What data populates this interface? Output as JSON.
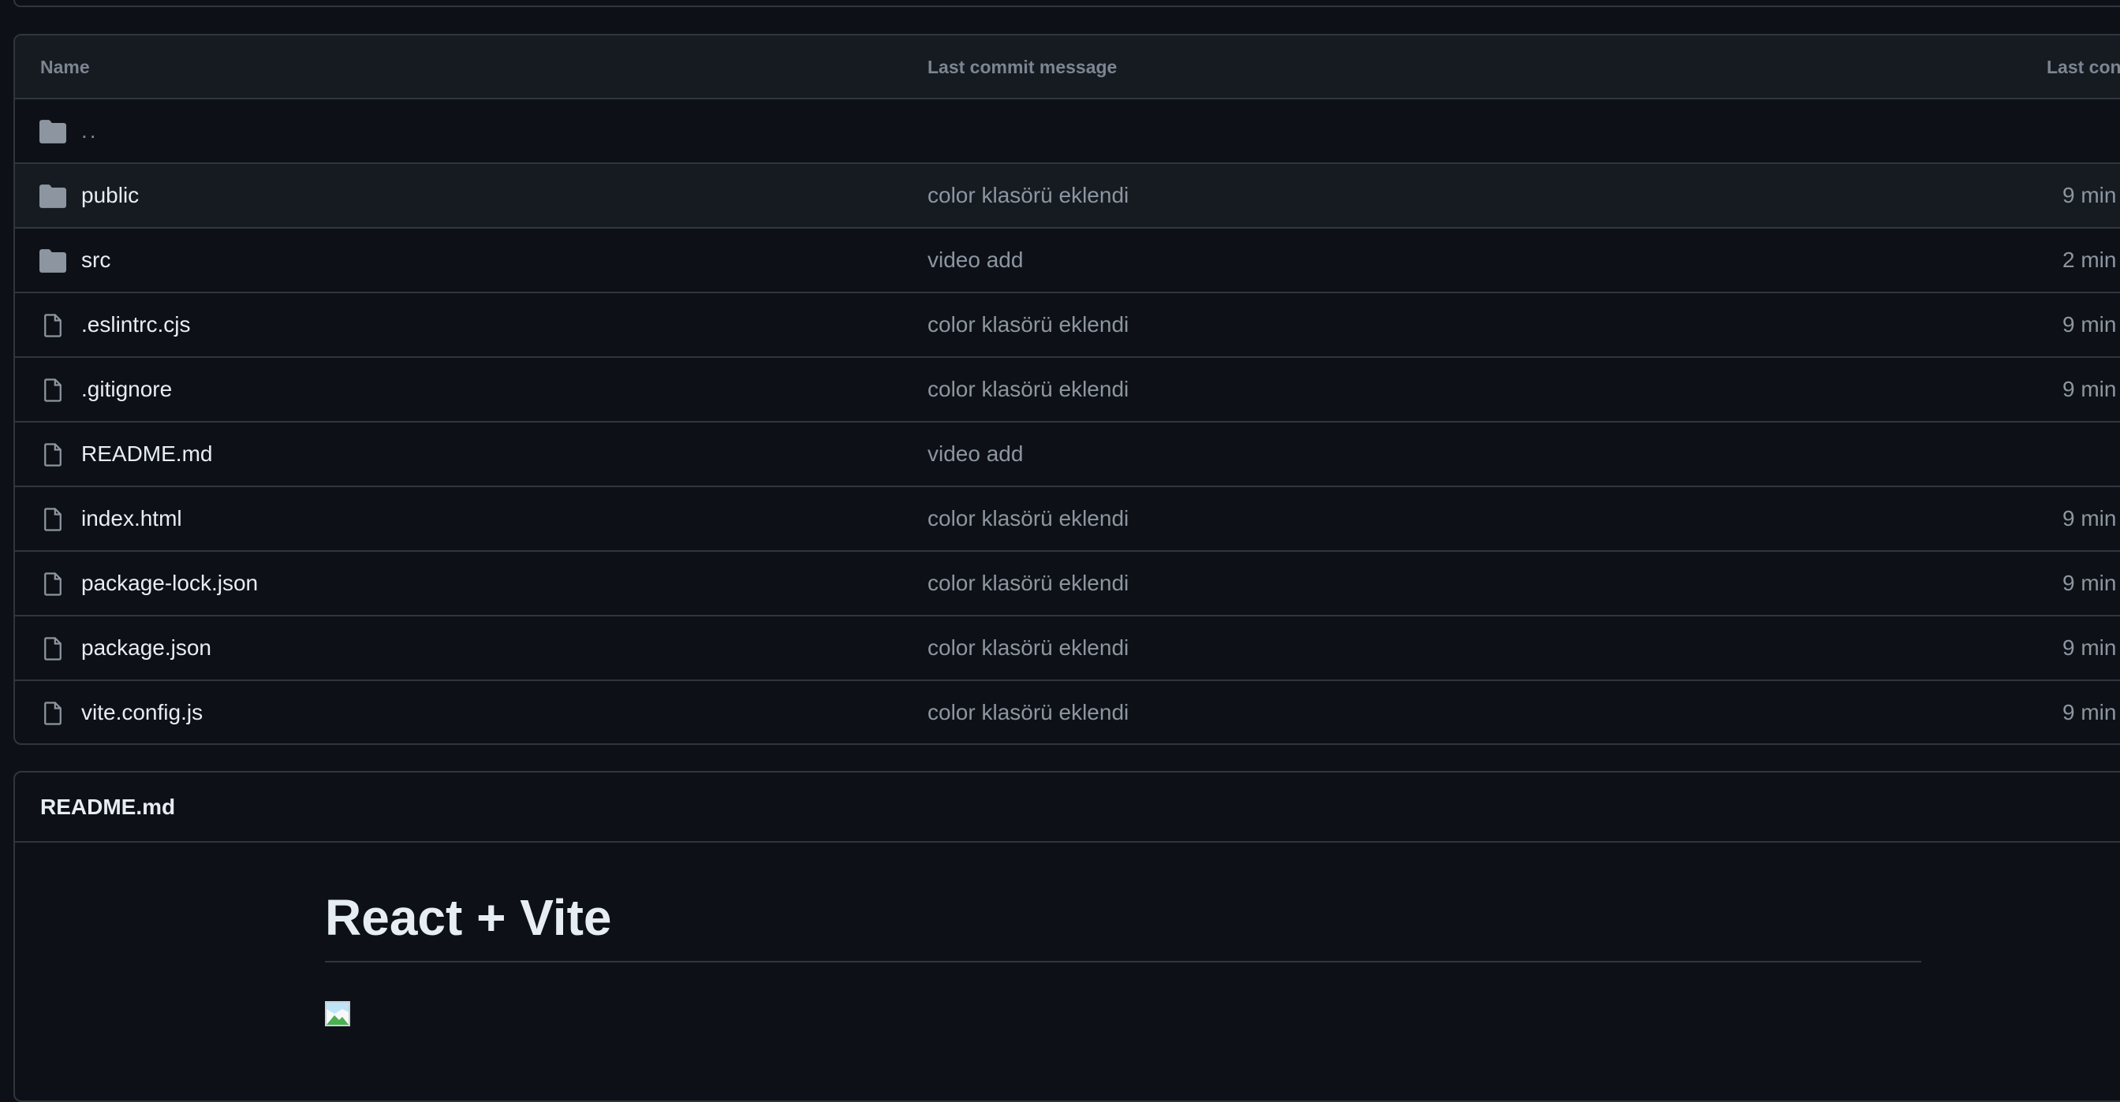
{
  "table": {
    "headers": {
      "name": "Name",
      "message": "Last commit message",
      "date": "Last con"
    },
    "parent": {
      "name": "..",
      "icon": "folder-icon"
    },
    "rows": [
      {
        "name": "public",
        "type": "folder",
        "icon": "folder-icon",
        "message": "color klasörü eklendi",
        "date": "9 min"
      },
      {
        "name": "src",
        "type": "folder",
        "icon": "folder-icon",
        "message": "video add",
        "date": "2 min"
      },
      {
        "name": ".eslintrc.cjs",
        "type": "file",
        "icon": "file-icon",
        "message": "color klasörü eklendi",
        "date": "9 min"
      },
      {
        "name": ".gitignore",
        "type": "file",
        "icon": "file-icon",
        "message": "color klasörü eklendi",
        "date": "9 min"
      },
      {
        "name": "README.md",
        "type": "file",
        "icon": "file-icon",
        "message": "video add",
        "date": ""
      },
      {
        "name": "index.html",
        "type": "file",
        "icon": "file-icon",
        "message": "color klasörü eklendi",
        "date": "9 min"
      },
      {
        "name": "package-lock.json",
        "type": "file",
        "icon": "file-icon",
        "message": "color klasörü eklendi",
        "date": "9 min"
      },
      {
        "name": "package.json",
        "type": "file",
        "icon": "file-icon",
        "message": "color klasörü eklendi",
        "date": "9 min"
      },
      {
        "name": "vite.config.js",
        "type": "file",
        "icon": "file-icon",
        "message": "color klasörü eklendi",
        "date": "9 min"
      }
    ]
  },
  "readme": {
    "title": "README.md",
    "heading": "React + Vite",
    "image_icon": "broken-image-icon"
  },
  "colors": {
    "background": "#0d1117",
    "header_background": "#161b22",
    "border": "#30363d",
    "text": "#e6edf3",
    "muted": "#8d96a0",
    "icon": "#8d96a0"
  }
}
